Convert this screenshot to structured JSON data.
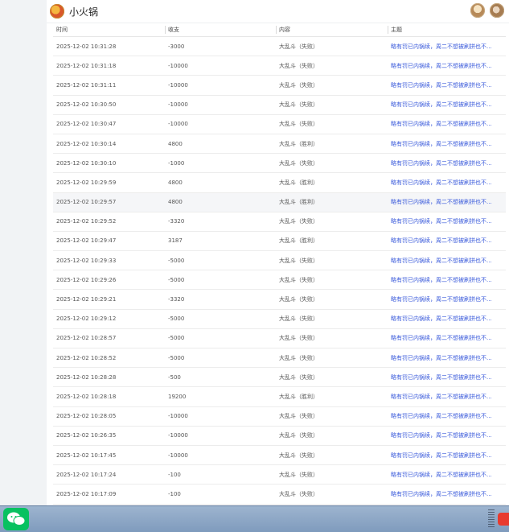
{
  "app": {
    "title": "小火锅"
  },
  "table": {
    "headers": [
      "时间",
      "收支",
      "内容",
      "主题"
    ],
    "rows": [
      [
        "2025-12-02 10:31:28",
        "-3000",
        "大乱斗（失败）",
        "略有罚已内锅续，周二不想被刷拼也不..."
      ],
      [
        "2025-12-02 10:31:18",
        "-10000",
        "大乱斗（失败）",
        "略有罚已内锅续，周二不想被刷拼也不..."
      ],
      [
        "2025-12-02 10:31:11",
        "-10000",
        "大乱斗（失败）",
        "略有罚已内锅续，周二不想被刷拼也不..."
      ],
      [
        "2025-12-02 10:30:50",
        "-10000",
        "大乱斗（失败）",
        "略有罚已内锅续，周二不想被刷拼也不..."
      ],
      [
        "2025-12-02 10:30:47",
        "-10000",
        "大乱斗（失败）",
        "略有罚已内锅续，周二不想被刷拼也不..."
      ],
      [
        "2025-12-02 10:30:14",
        "4800",
        "大乱斗（胜利）",
        "略有罚已内锅续，周二不想被刷拼也不..."
      ],
      [
        "2025-12-02 10:30:10",
        "-1000",
        "大乱斗（失败）",
        "略有罚已内锅续，周二不想被刷拼也不..."
      ],
      [
        "2025-12-02 10:29:59",
        "4800",
        "大乱斗（胜利）",
        "略有罚已内锅续，周二不想被刷拼也不..."
      ],
      [
        "2025-12-02 10:29:57",
        "4800",
        "大乱斗（胜利）",
        "略有罚已内锅续，周二不想被刷拼也不..."
      ],
      [
        "2025-12-02 10:29:52",
        "-3320",
        "大乱斗（失败）",
        "略有罚已内锅续，周二不想被刷拼也不..."
      ],
      [
        "2025-12-02 10:29:47",
        "3187",
        "大乱斗（胜利）",
        "略有罚已内锅续，周二不想被刷拼也不..."
      ],
      [
        "2025-12-02 10:29:33",
        "-5000",
        "大乱斗（失败）",
        "略有罚已内锅续，周二不想被刷拼也不..."
      ],
      [
        "2025-12-02 10:29:26",
        "-5000",
        "大乱斗（失败）",
        "略有罚已内锅续，周二不想被刷拼也不..."
      ],
      [
        "2025-12-02 10:29:21",
        "-3320",
        "大乱斗（失败）",
        "略有罚已内锅续，周二不想被刷拼也不..."
      ],
      [
        "2025-12-02 10:29:12",
        "-5000",
        "大乱斗（失败）",
        "略有罚已内锅续，周二不想被刷拼也不..."
      ],
      [
        "2025-12-02 10:28:57",
        "-5000",
        "大乱斗（失败）",
        "略有罚已内锅续，周二不想被刷拼也不..."
      ],
      [
        "2025-12-02 10:28:52",
        "-5000",
        "大乱斗（失败）",
        "略有罚已内锅续，周二不想被刷拼也不..."
      ],
      [
        "2025-12-02 10:28:28",
        "-500",
        "大乱斗（失败）",
        "略有罚已内锅续，周二不想被刷拼也不..."
      ],
      [
        "2025-12-02 10:28:18",
        "19200",
        "大乱斗（胜利）",
        "略有罚已内锅续，周二不想被刷拼也不..."
      ],
      [
        "2025-12-02 10:28:05",
        "-10000",
        "大乱斗（失败）",
        "略有罚已内锅续，周二不想被刷拼也不..."
      ],
      [
        "2025-12-02 10:26:35",
        "-10000",
        "大乱斗（失败）",
        "略有罚已内锅续，周二不想被刷拼也不..."
      ],
      [
        "2025-12-02 10:17:45",
        "-10000",
        "大乱斗（失败）",
        "略有罚已内锅续，周二不想被刷拼也不..."
      ],
      [
        "2025-12-02 10:17:24",
        "-100",
        "大乱斗（失败）",
        "略有罚已内锅续，周二不想被刷拼也不..."
      ],
      [
        "2025-12-02 10:17:09",
        "-100",
        "大乱斗（失败）",
        "略有罚已内锅续，周二不想被刷拼也不..."
      ]
    ],
    "highlighted_row": 8
  },
  "icons": {
    "app_logo": "hotpot-logo-icon",
    "avatar_1": "user-avatar-icon",
    "avatar_2": "user-avatar-icon",
    "taskbar_app": "wechat-icon",
    "tray": "input-method-icon"
  },
  "colors": {
    "topic_link": "#3b5bdb",
    "wechat": "#07c160",
    "taskbar": "#8fa8c6"
  }
}
